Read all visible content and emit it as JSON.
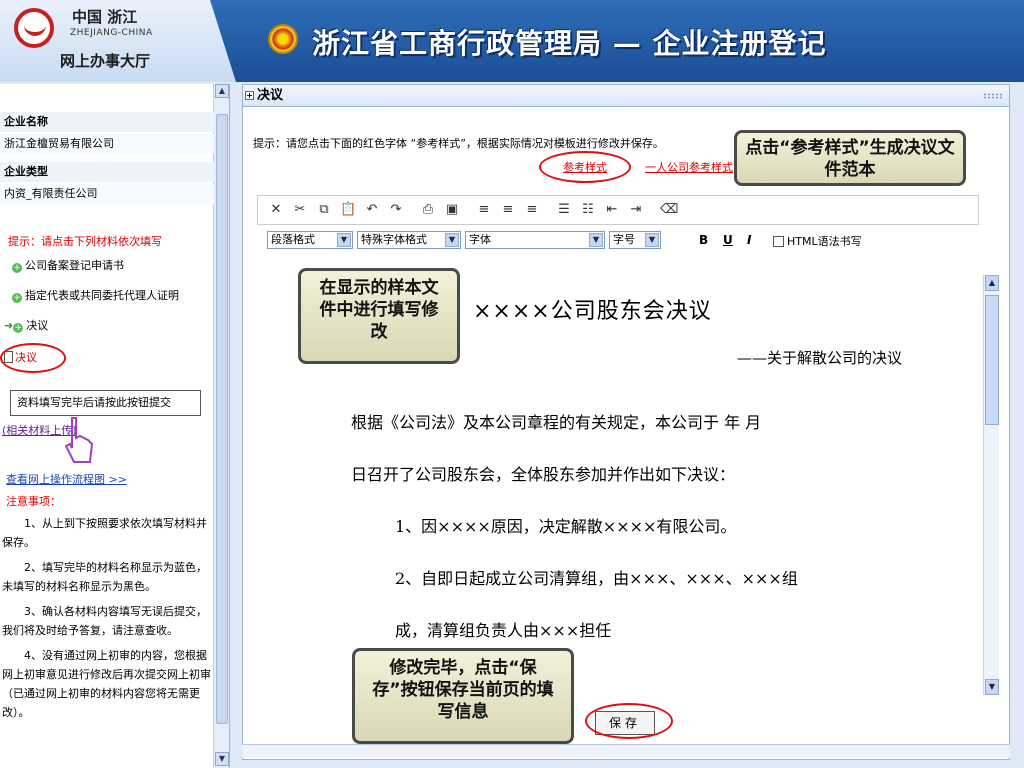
{
  "header": {
    "logo_cn": "中国 浙江",
    "logo_en": "ZHEJIANG-CHINA",
    "logo_sub": "网上办事大厅",
    "site_title": "浙江省工商行政管理局 — 企业注册登记"
  },
  "sidebar": {
    "company_name_label": "企业名称",
    "company_name_value": "浙江金檀贸易有限公司",
    "company_type_label": "企业类型",
    "company_type_value": "内资_有限责任公司",
    "hint": "提示：请点击下列材料依次填写",
    "items": [
      {
        "label": "公司备案登记申请书"
      },
      {
        "label": "指定代表或共同委托代理人证明"
      },
      {
        "label": "决议"
      },
      {
        "label": "决议"
      }
    ],
    "submit_button": "资料填写完毕后请按此按钮提交",
    "upload_link": "(相关材料上传)",
    "flow_link": "查看网上操作流程图 >>",
    "notes_title": "注意事项：",
    "notes": [
      "1、从上到下按照要求依次填写材料并保存。",
      "2、填写完毕的材料名称显示为蓝色，未填写的材料名称显示为黑色。",
      "3、确认各材料内容填写无误后提交，我们将及时给予答复，请注意查收。",
      "4、没有通过网上初审的内容，您根据网上初审意见进行修改后再次提交网上初审（已通过网上初审的材料内容您将无需更改）。"
    ]
  },
  "main": {
    "panel_title": "决议",
    "hint_text": "提示：请您点击下面的红色字体 “参考样式”，根据实际情况对模板进行修改并保存。",
    "ref_style_link": "参考样式",
    "single_ref_link": "一人公司参考样式",
    "toolbar_icons": [
      "cut-icon",
      "scissors-icon",
      "copy-icon",
      "paste-icon",
      "undo-icon",
      "redo-icon",
      "print-icon",
      "save-icon",
      "align-left-icon",
      "align-center-icon",
      "align-right-icon",
      "ordered-list-icon",
      "unordered-list-icon",
      "outdent-icon",
      "indent-icon",
      "clear-format-icon"
    ],
    "format_selects": {
      "paragraph": "段落格式",
      "special_font": "特殊字体格式",
      "font": "字体",
      "size": "字号"
    },
    "bold": "B",
    "underline": "U",
    "italic": "I",
    "html_mode": "HTML语法书写",
    "doc": {
      "title": "××××公司股东会决议",
      "subtitle": "——关于解散公司的决议",
      "p1": "根据《公司法》及本公司章程的有关规定，本公司于  年  月",
      "p2": "日召开了公司股东会，全体股东参加并作出如下决议：",
      "p3": "1、因××××原因，决定解散××××有限公司。",
      "p4": "2、自即日起成立公司清算组，由×××、×××、×××组",
      "p5": "成，清算组负责人由×××担任"
    },
    "save_button": "保存"
  },
  "callouts": {
    "ref": "点击“参考样式”生成决议文件范本",
    "edit": "在显示的样本文件中进行填写修改",
    "save": "修改完毕，点击“保存”按钮保存当前页的填写信息"
  }
}
